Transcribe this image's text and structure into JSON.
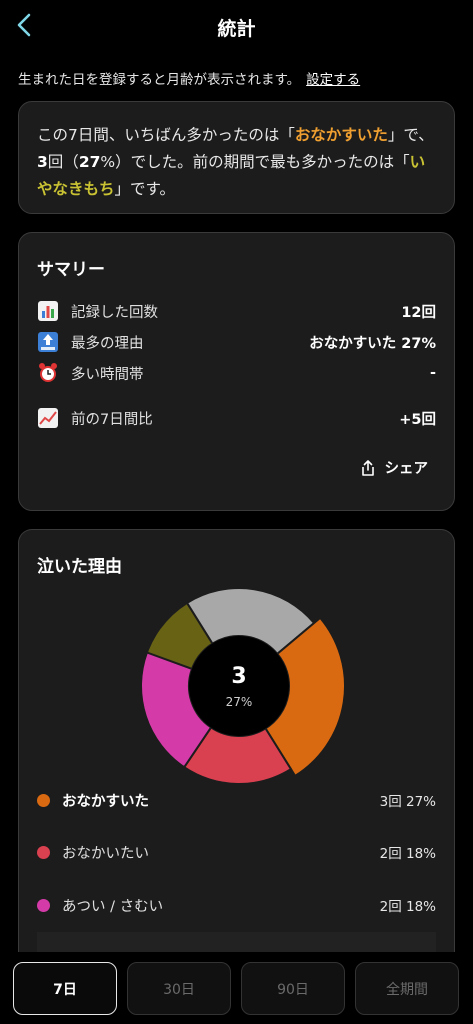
{
  "header": {
    "title": "統計"
  },
  "notice": {
    "text": "生まれた日を登録すると月齢が表示されます。",
    "link": "設定する"
  },
  "highlight": {
    "p1": "この7日間、いちばん多かったのは「",
    "top_reason": "おなかすいた",
    "p2": "」で、",
    "count": "3",
    "p3": "回（",
    "percent": "27",
    "p4": "%）でした。前の期間で最も多かったのは「",
    "prev_reason": "いやなきもち",
    "p5": "」です。"
  },
  "summary": {
    "title": "サマリー",
    "rows": [
      {
        "label": "記録した回数",
        "value": "12回",
        "icon": "bar-chart-icon"
      },
      {
        "label": "最多の理由",
        "value": "おなかすいた 27%",
        "icon": "top-icon"
      },
      {
        "label": "多い時間帯",
        "value": "-",
        "icon": "alarm-clock-icon"
      },
      {
        "label": "前の7日間比",
        "value": "+5回",
        "icon": "trend-up-icon"
      }
    ],
    "share_label": "シェア"
  },
  "reasons": {
    "title": "泣いた理由",
    "center_value": "3",
    "center_percent": "27%",
    "legend": [
      {
        "name": "おなかすいた",
        "value": "3回 27%",
        "color": "#d96a12"
      },
      {
        "name": "おなかいたい",
        "value": "2回 18%",
        "color": "#d94050"
      },
      {
        "name": "あつい / さむい",
        "value": "2回 18%",
        "color": "#d43ba8"
      }
    ]
  },
  "chart_data": {
    "type": "pie",
    "categories": [
      "おなかすいた",
      "おなかいたい",
      "あつい / さむい"
    ],
    "values": [
      3,
      2,
      2
    ],
    "percents": [
      27,
      18,
      18
    ],
    "colors": [
      "#d96a12",
      "#d94050",
      "#d43ba8"
    ],
    "extra_slice_colors": [
      "#686214",
      "#a8a8a8"
    ],
    "selected_offset": 0
  },
  "tabs": [
    {
      "label": "7日",
      "active": true
    },
    {
      "label": "30日",
      "active": false
    },
    {
      "label": "90日",
      "active": false
    },
    {
      "label": "全期間",
      "active": false
    }
  ]
}
